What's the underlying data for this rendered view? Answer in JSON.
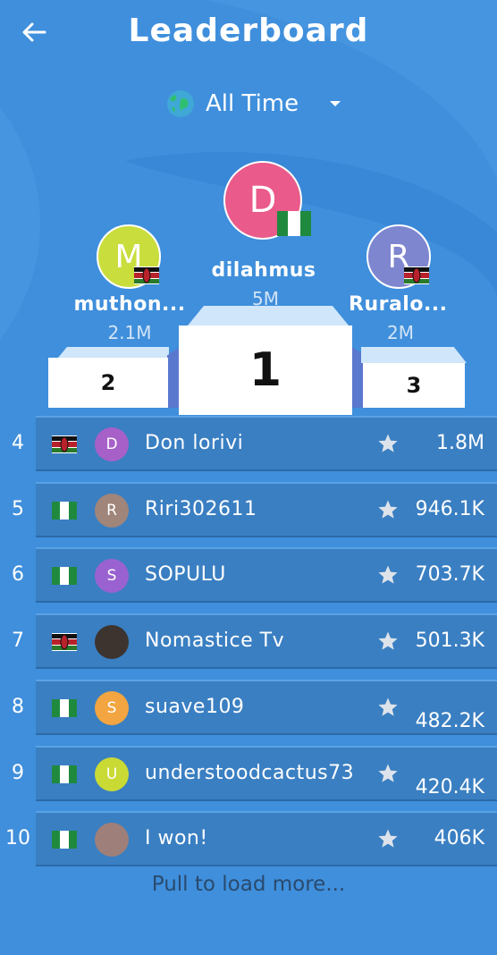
{
  "header": {
    "title": "Leaderboard",
    "back_icon": "arrow-left-icon"
  },
  "filter": {
    "label": "All Time",
    "icon": "globe-icon",
    "dropdown_icon": "caret-down-icon"
  },
  "podium": {
    "first": {
      "initial": "D",
      "name": "dilahmus",
      "score": "5M",
      "rank": "1",
      "avatar_color": "#ea5a8a",
      "flag": "nigeria"
    },
    "second": {
      "initial": "M",
      "name": "muthon...",
      "score": "2.1M",
      "rank": "2",
      "avatar_color": "#c9dd3c",
      "flag": "kenya"
    },
    "third": {
      "initial": "R",
      "name": "Ruralo...",
      "score": "2M",
      "rank": "3",
      "avatar_color": "#7e86cf",
      "flag": "kenya"
    }
  },
  "rows": [
    {
      "rank": "4",
      "flag": "kenya",
      "initial": "D",
      "avatar_color": "#a760c8",
      "name": "Don lorivi",
      "score": "1.8M",
      "low": false
    },
    {
      "rank": "5",
      "flag": "nigeria",
      "initial": "R",
      "avatar_color": "#a0857a",
      "name": "Riri302611",
      "score": "946.1K",
      "low": false
    },
    {
      "rank": "6",
      "flag": "nigeria",
      "initial": "S",
      "avatar_color": "#9a62d0",
      "name": "SOPULU",
      "score": "703.7K",
      "low": false
    },
    {
      "rank": "7",
      "flag": "kenya",
      "initial": "",
      "avatar_color": "#3d342f",
      "name": "Nomastice Tv",
      "score": "501.3K",
      "low": false
    },
    {
      "rank": "8",
      "flag": "nigeria",
      "initial": "S",
      "avatar_color": "#f2a540",
      "name": "suave109",
      "score": "482.2K",
      "low": true
    },
    {
      "rank": "9",
      "flag": "nigeria",
      "initial": "U",
      "avatar_color": "#c9da35",
      "name": "understoodcactus73",
      "score": "420.4K",
      "low": true
    },
    {
      "rank": "10",
      "flag": "nigeria",
      "initial": "",
      "avatar_color": "#9e7f79",
      "name": "I won!",
      "score": "406K",
      "low": false
    }
  ],
  "footer": {
    "load_more": "Pull to load more..."
  },
  "colors": {
    "background": "#3f8fdc",
    "row": "#3a7fc2",
    "podium_block": "#ffffff"
  }
}
